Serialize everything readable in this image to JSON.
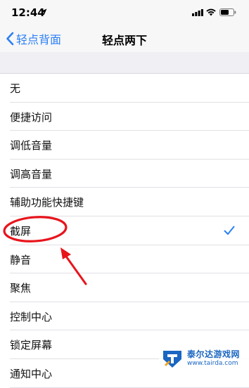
{
  "status_bar": {
    "time": "12:44"
  },
  "nav": {
    "back_label": "轻点背面",
    "title": "轻点两下"
  },
  "options": [
    {
      "label": "无",
      "selected": false
    },
    {
      "label": "便捷访问",
      "selected": false
    },
    {
      "label": "调低音量",
      "selected": false
    },
    {
      "label": "调高音量",
      "selected": false
    },
    {
      "label": "辅助功能快捷键",
      "selected": false
    },
    {
      "label": "截屏",
      "selected": true
    },
    {
      "label": "静音",
      "selected": false
    },
    {
      "label": "聚焦",
      "selected": false
    },
    {
      "label": "控制中心",
      "selected": false
    },
    {
      "label": "锁定屏幕",
      "selected": false
    },
    {
      "label": "通知中心",
      "selected": false
    }
  ],
  "colors": {
    "accent": "#2b7ff6",
    "annotation": "#e8141c"
  },
  "watermark": {
    "title": "泰尔达游戏网",
    "url": "www.tairda.com"
  }
}
